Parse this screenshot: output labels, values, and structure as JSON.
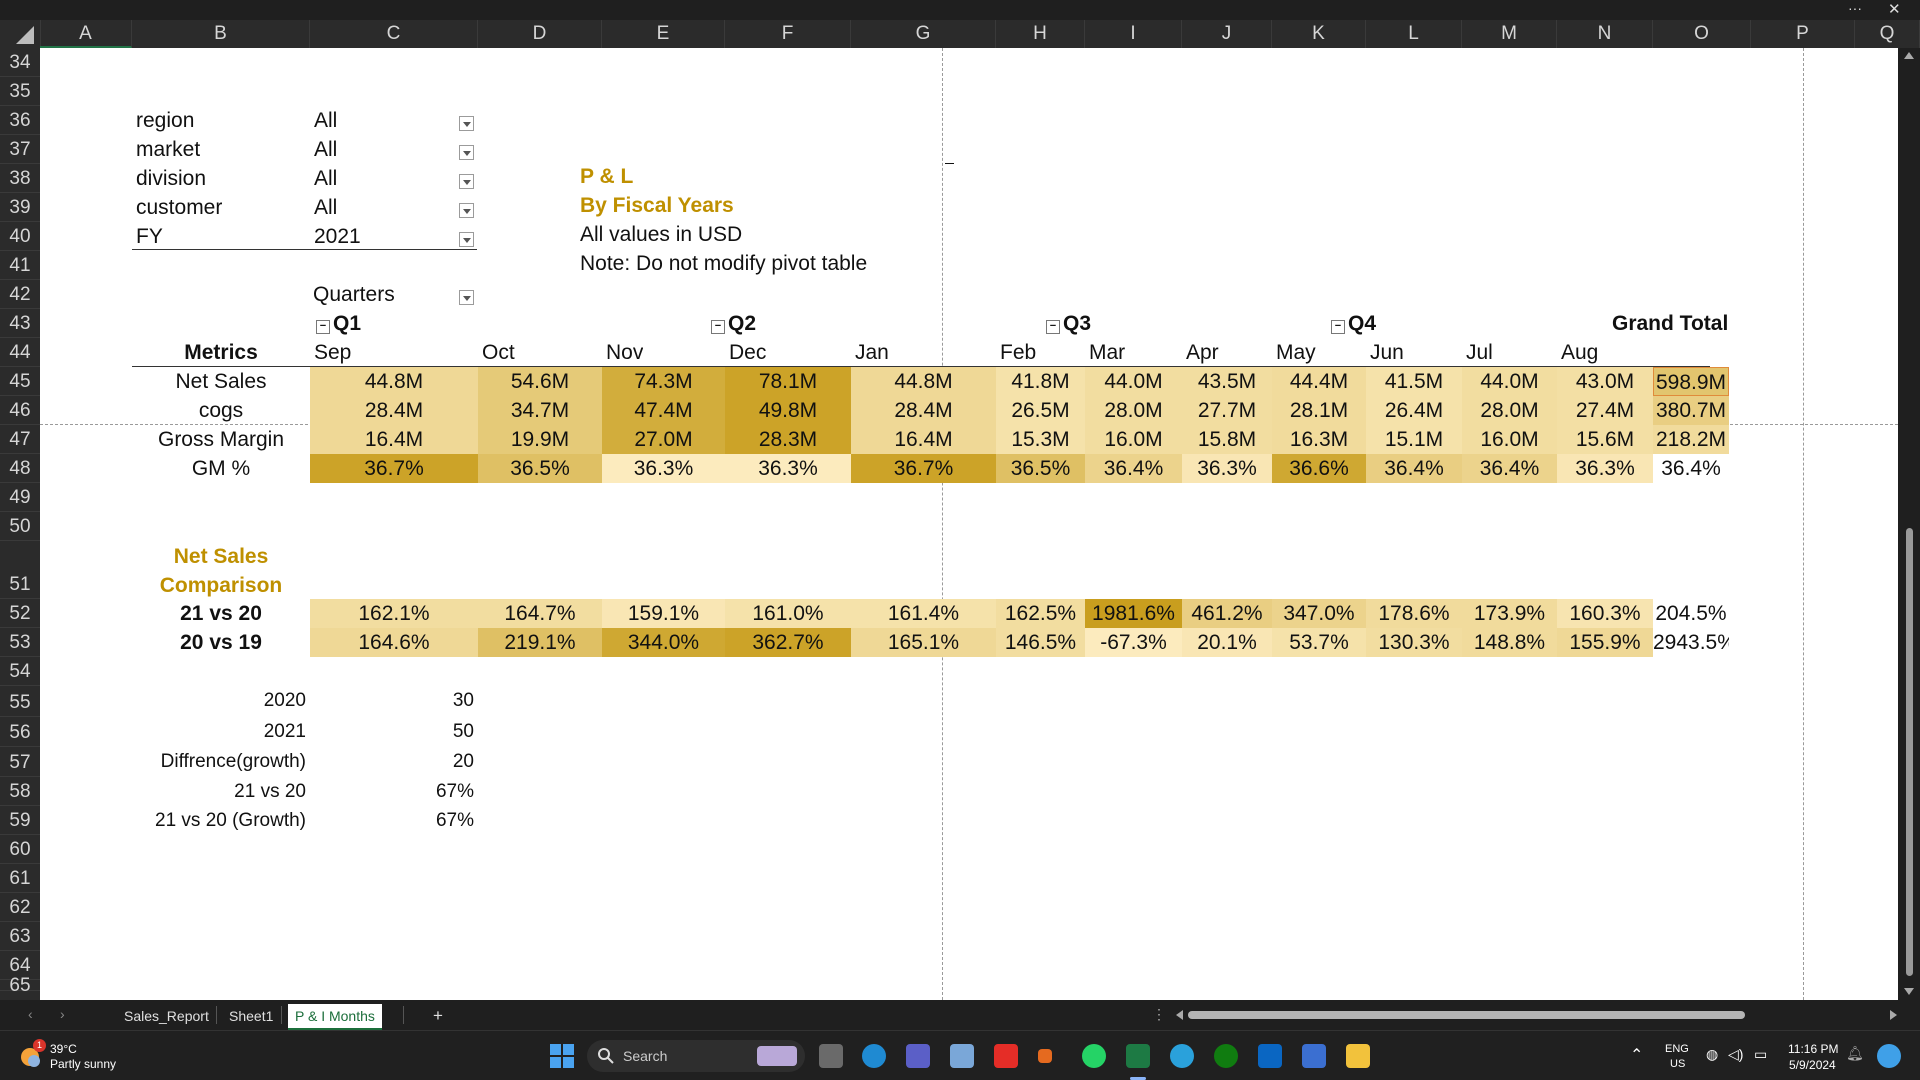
{
  "window": {
    "more_label": "···",
    "close_label": "✕"
  },
  "columns": [
    "A",
    "B",
    "C",
    "D",
    "E",
    "F",
    "G",
    "H",
    "I",
    "J",
    "K",
    "L",
    "M",
    "N",
    "O",
    "P",
    "Q"
  ],
  "rows": [
    "34",
    "35",
    "36",
    "37",
    "38",
    "39",
    "40",
    "41",
    "42",
    "43",
    "44",
    "45",
    "46",
    "47",
    "48",
    "49",
    "50",
    "51",
    "52",
    "53",
    "54",
    "55",
    "56",
    "57",
    "58",
    "59",
    "60",
    "61",
    "62",
    "63",
    "64",
    "65"
  ],
  "filters": [
    {
      "label": "region",
      "value": "All"
    },
    {
      "label": "market",
      "value": "All"
    },
    {
      "label": "division",
      "value": "All"
    },
    {
      "label": "customer",
      "value": "All"
    },
    {
      "label": "FY",
      "value": "2021"
    }
  ],
  "quarters_label": "Quarters",
  "info": {
    "title": "P & L",
    "subtitle": "By Fiscal Years",
    "currency_note": "All values in USD",
    "note": "Note: Do not modify pivot table",
    "cursor_mark": "_"
  },
  "quarters": [
    "Q1",
    "Q2",
    "Q3",
    "Q4"
  ],
  "grand_total_label": "Grand Total",
  "metrics_label": "Metrics",
  "months": [
    "Sep",
    "Oct",
    "Nov",
    "Dec",
    "Jan",
    "Feb",
    "Mar",
    "Apr",
    "May",
    "Jun",
    "Jul",
    "Aug"
  ],
  "pnl_rows": [
    {
      "label": "Net Sales",
      "values": [
        "44.8M",
        "54.6M",
        "74.3M",
        "78.1M",
        "44.8M",
        "41.8M",
        "44.0M",
        "43.5M",
        "44.4M",
        "41.5M",
        "44.0M",
        "43.0M"
      ],
      "total": "598.9M",
      "levels": [
        0.25,
        0.4,
        0.7,
        0.8,
        0.25,
        0.15,
        0.2,
        0.2,
        0.22,
        0.15,
        0.2,
        0.18
      ]
    },
    {
      "label": "cogs",
      "values": [
        "28.4M",
        "34.7M",
        "47.4M",
        "49.8M",
        "28.4M",
        "26.5M",
        "28.0M",
        "27.7M",
        "28.1M",
        "26.4M",
        "28.0M",
        "27.4M"
      ],
      "total": "380.7M",
      "levels": [
        0.25,
        0.4,
        0.7,
        0.8,
        0.25,
        0.15,
        0.2,
        0.2,
        0.22,
        0.15,
        0.2,
        0.18
      ]
    },
    {
      "label": "Gross Margin",
      "values": [
        "16.4M",
        "19.9M",
        "27.0M",
        "28.3M",
        "16.4M",
        "15.3M",
        "16.0M",
        "15.8M",
        "16.3M",
        "15.1M",
        "16.0M",
        "15.6M"
      ],
      "total": "218.2M",
      "levels": [
        0.25,
        0.4,
        0.7,
        0.8,
        0.25,
        0.15,
        0.2,
        0.2,
        0.22,
        0.15,
        0.2,
        0.18
      ]
    },
    {
      "label": "GM %",
      "values": [
        "36.7%",
        "36.5%",
        "36.3%",
        "36.3%",
        "36.7%",
        "36.5%",
        "36.4%",
        "36.3%",
        "36.6%",
        "36.4%",
        "36.4%",
        "36.3%"
      ],
      "total": "36.4%",
      "levels": [
        0.8,
        0.5,
        0.05,
        0.05,
        0.8,
        0.5,
        0.3,
        0.1,
        0.75,
        0.35,
        0.3,
        0.1
      ]
    }
  ],
  "comparison": {
    "title_line1": "Net Sales",
    "title_line2": "Comparison",
    "rows": [
      {
        "label": "21 vs 20",
        "values": [
          "162.1%",
          "164.7%",
          "159.1%",
          "161.0%",
          "161.4%",
          "162.5%",
          "1981.6%",
          "461.2%",
          "347.0%",
          "178.6%",
          "173.9%",
          "160.3%"
        ],
        "total": "204.5%",
        "levels": [
          0.2,
          0.2,
          0.1,
          0.15,
          0.15,
          0.2,
          0.85,
          0.35,
          0.3,
          0.22,
          0.22,
          0.12
        ]
      },
      {
        "label": "20 vs 19",
        "values": [
          "164.6%",
          "219.1%",
          "344.0%",
          "362.7%",
          "165.1%",
          "146.5%",
          "-67.3%",
          "20.1%",
          "53.7%",
          "130.3%",
          "148.8%",
          "155.9%"
        ],
        "total": "2943.5%",
        "levels": [
          0.25,
          0.5,
          0.75,
          0.8,
          0.25,
          0.2,
          0.05,
          0.1,
          0.15,
          0.2,
          0.22,
          0.25
        ]
      }
    ]
  },
  "growth": [
    {
      "label": "2020",
      "value": "30"
    },
    {
      "label": "2021",
      "value": "50"
    },
    {
      "label": "Diffrence(growth)",
      "value": "20"
    },
    {
      "label": "21 vs  20",
      "value": "67%"
    },
    {
      "label": "21 vs 20 (Growth)",
      "value": "67%"
    }
  ],
  "sheet_tabs": [
    "Sales_Report",
    "Sheet1",
    "P & I Months"
  ],
  "active_tab": "P & I Months",
  "add_sheet_label": "+",
  "taskbar": {
    "weather_temp": "39°C",
    "weather_desc": "Partly sunny",
    "weather_badge": "1",
    "search_label": "Search",
    "lang_line1": "ENG",
    "lang_line2": "US",
    "time": "11:16 PM",
    "date": "5/9/2024"
  }
}
